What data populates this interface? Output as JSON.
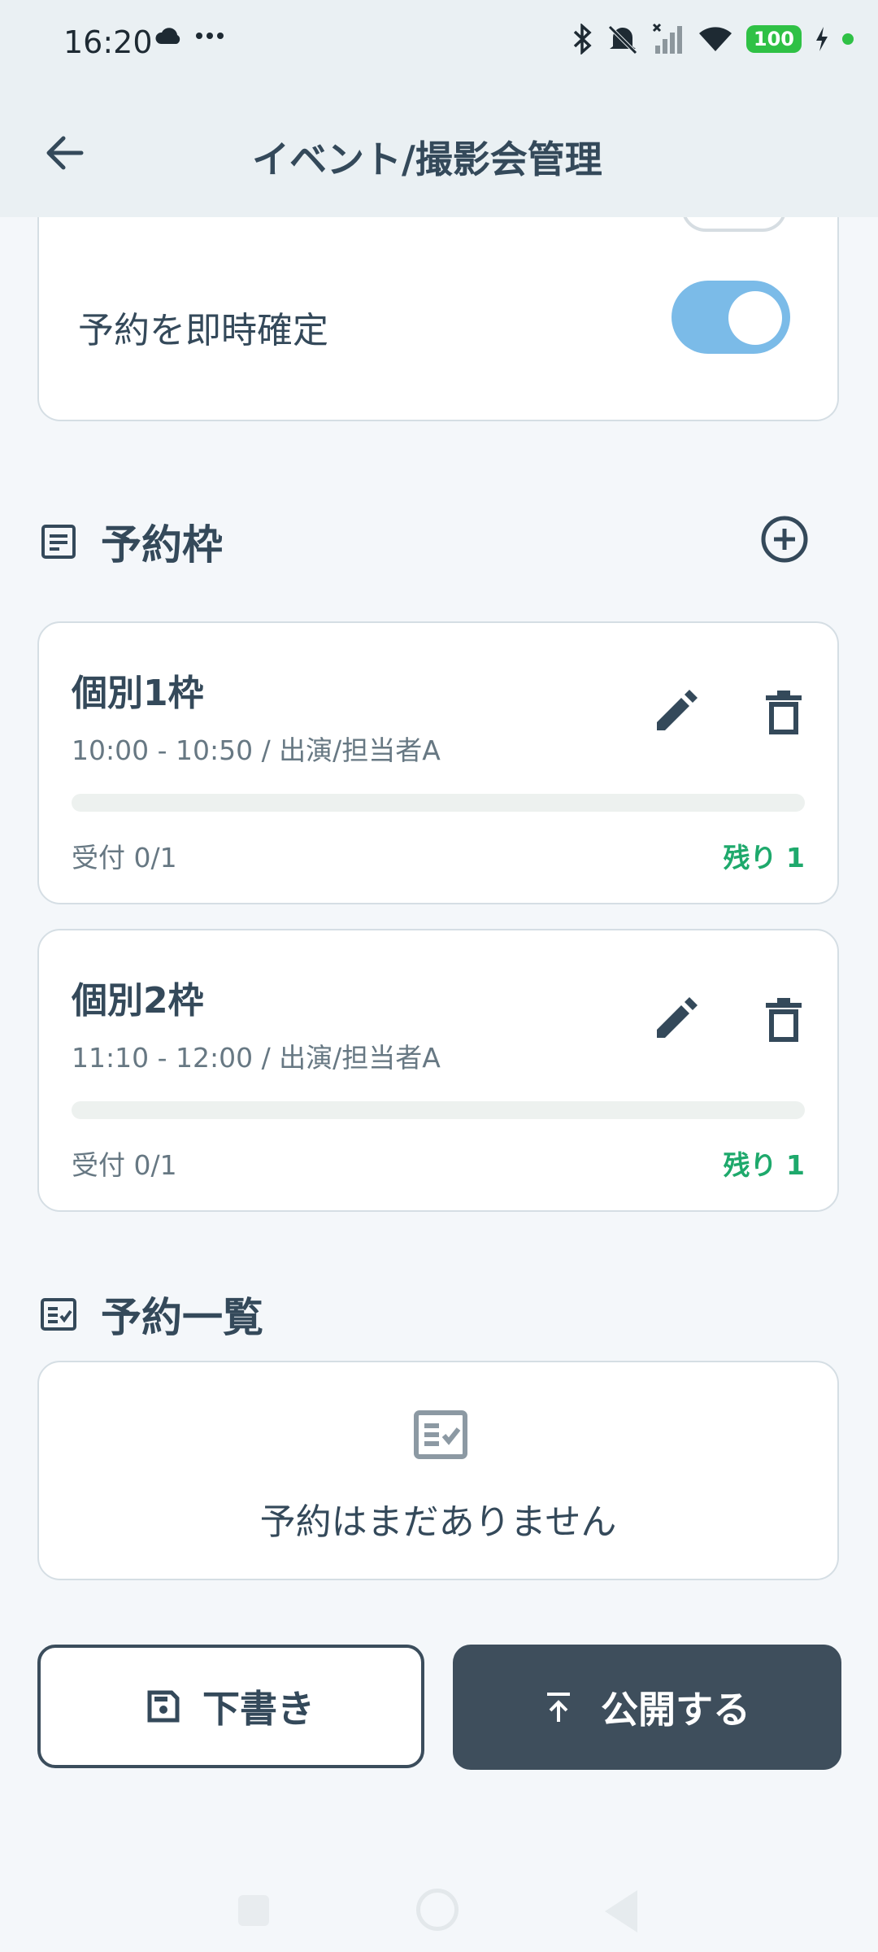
{
  "status": {
    "time": "16:20",
    "battery": "100"
  },
  "appbar": {
    "title": "イベント/撮影会管理"
  },
  "settings": {
    "instant_confirm_label": "予約を即時確定",
    "instant_confirm_on": true
  },
  "slots_section": {
    "title": "予約枠"
  },
  "slots": [
    {
      "title": "個別1枠",
      "meta": "10:00 - 10:50 / 出演/担当者A",
      "count": "受付 0/1",
      "remaining": "残り 1",
      "fill": 0.0
    },
    {
      "title": "個別2枠",
      "meta": "11:10 - 12:00 / 出演/担当者A",
      "count": "受付 0/1",
      "remaining": "残り 1",
      "fill": 0.0
    }
  ],
  "reservations_section": {
    "title": "予約一覧",
    "empty_text": "予約はまだありません"
  },
  "actions": {
    "draft_label": "下書き",
    "publish_label": "公開する"
  },
  "colors": {
    "accent": "#3e4e5c",
    "toggle_on": "#7bbbe8",
    "success": "#1ea96c"
  },
  "icons": [
    "cloud-icon",
    "more-icon",
    "bluetooth-icon",
    "mute-icon",
    "signal-icon",
    "wifi-icon",
    "charging-icon",
    "back-arrow-icon",
    "note-icon",
    "add-circle-icon",
    "edit-icon",
    "delete-icon",
    "checklist-icon",
    "save-icon",
    "upload-icon"
  ]
}
